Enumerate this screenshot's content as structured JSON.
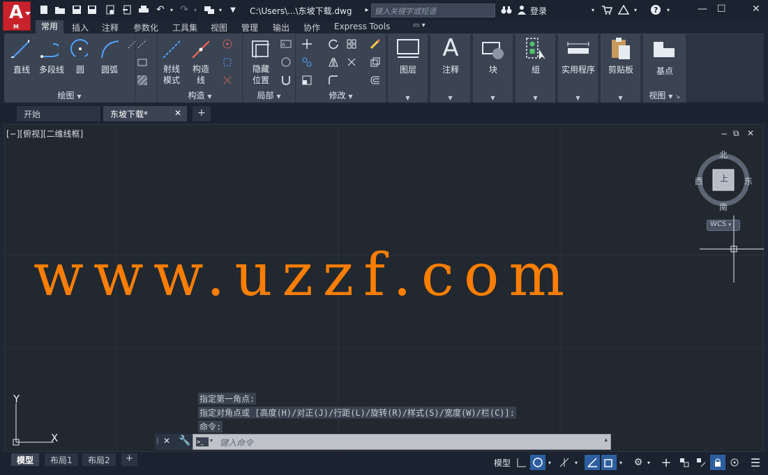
{
  "app": {
    "logo_letter": "A",
    "logo_sub": "M",
    "document_title": "C:\\Users\\...\\东坡下载.dwg",
    "search_placeholder": "键入关键字或短语",
    "login_label": "登录"
  },
  "ribbon_tabs": [
    "常用",
    "插入",
    "注释",
    "参数化",
    "工具集",
    "视图",
    "管理",
    "输出",
    "协作",
    "Express Tools"
  ],
  "ribbon_active_tab": "常用",
  "ribbon": {
    "draw": {
      "title": "绘图",
      "line": "直线",
      "polyline": "多段线",
      "circle": "圆",
      "arc": "圆弧"
    },
    "construct": {
      "title": "构造",
      "ray": "射线",
      "ray2": "模式",
      "xline": "构造",
      "xline2": "线"
    },
    "local": {
      "title": "局部",
      "hide": "隐藏",
      "hide2": "位置"
    },
    "modify": {
      "title": "修改"
    },
    "layers": {
      "label": "图层"
    },
    "annotation": {
      "label": "注释"
    },
    "block": {
      "label": "块"
    },
    "group": {
      "label": "组"
    },
    "utilities": {
      "label": "实用程序"
    },
    "clipboard": {
      "label": "剪贴板"
    },
    "view": {
      "label": "基点",
      "title": "视图"
    }
  },
  "file_tabs": [
    {
      "label": "开始"
    },
    {
      "label": "东坡下载*"
    }
  ],
  "viewport": {
    "label": "[−][俯视][二维线框]",
    "watermark": "www.uzzf.com"
  },
  "viewcube": {
    "north": "北",
    "south": "南",
    "east": "东",
    "west": "西",
    "top_face": "上",
    "wcs": "WCS"
  },
  "ucs": {
    "x": "X",
    "y": "Y"
  },
  "command": {
    "history": [
      "指定第一角点:",
      "指定对角点或 [高度(H)/对正(J)/行距(L)/旋转(R)/样式(S)/宽度(W)/栏(C)]:",
      "命令:"
    ],
    "placeholder": "键入命令"
  },
  "layout_tabs": [
    "模型",
    "布局1",
    "布局2"
  ],
  "status": {
    "model_label": "模型"
  },
  "colors": {
    "accent": "#2d5fa0",
    "watermark": "#ff7e00",
    "logo": "#c8232c"
  }
}
